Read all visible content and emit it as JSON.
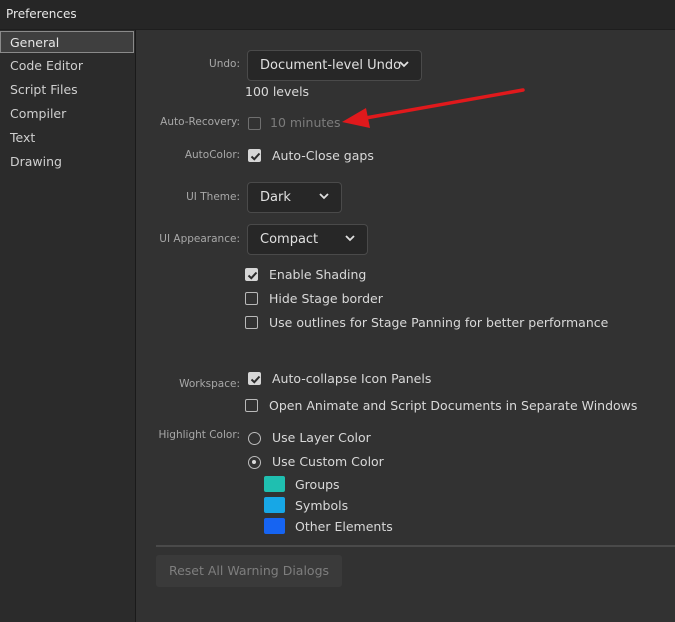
{
  "window": {
    "title": "Preferences"
  },
  "sidebar": {
    "items": [
      {
        "label": "General",
        "selected": true
      },
      {
        "label": "Code Editor"
      },
      {
        "label": "Script Files"
      },
      {
        "label": "Compiler"
      },
      {
        "label": "Text"
      },
      {
        "label": "Drawing"
      }
    ]
  },
  "general": {
    "undo": {
      "label": "Undo:",
      "value": "Document-level Undo",
      "levels": "100 levels"
    },
    "auto_recovery": {
      "label": "Auto-Recovery:",
      "checked": false,
      "value": "10 minutes"
    },
    "autocolor": {
      "label": "AutoColor:",
      "option": "Auto-Close gaps",
      "checked": true
    },
    "ui_theme": {
      "label": "UI Theme:",
      "value": "Dark"
    },
    "ui_appearance": {
      "label": "UI Appearance:",
      "value": "Compact"
    },
    "appearance_options": [
      {
        "label": "Enable Shading",
        "checked": true
      },
      {
        "label": "Hide Stage border",
        "checked": false
      },
      {
        "label": "Use outlines for Stage Panning for better performance",
        "checked": false
      }
    ],
    "workspace": {
      "label": "Workspace:",
      "options": [
        {
          "label": "Auto-collapse Icon Panels",
          "checked": true
        },
        {
          "label": "Open Animate and Script Documents in Separate Windows",
          "checked": false
        }
      ]
    },
    "highlight_color": {
      "label": "Highlight Color:",
      "options": [
        {
          "label": "Use Layer Color",
          "selected": false
        },
        {
          "label": "Use Custom Color",
          "selected": true
        }
      ],
      "custom": [
        {
          "label": "Groups",
          "color": "#1fbfb0"
        },
        {
          "label": "Symbols",
          "color": "#17a7e6"
        },
        {
          "label": "Other Elements",
          "color": "#1664f2"
        }
      ]
    },
    "reset_button": "Reset All Warning Dialogs"
  },
  "colors": {
    "window_bg": "#323232",
    "sidebar_bg": "#2b2b2b",
    "annotation_arrow": "#e0191c"
  },
  "annotation": {
    "type": "arrow",
    "points_to": "auto-recovery-value"
  }
}
